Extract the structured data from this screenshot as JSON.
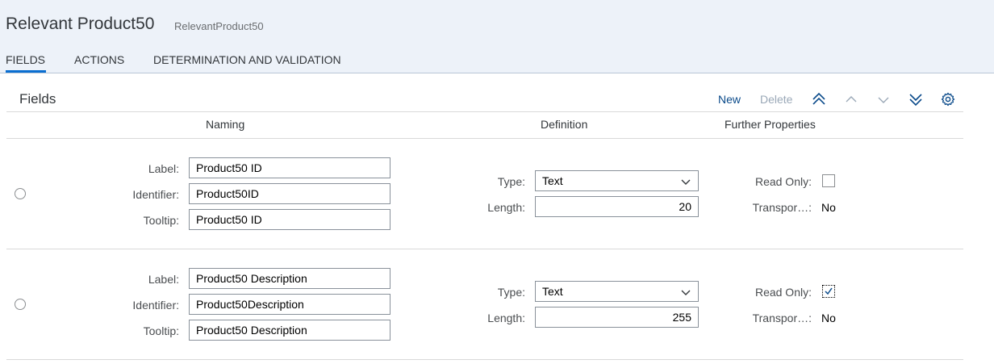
{
  "header": {
    "title": "Relevant Product50",
    "subtitle": "RelevantProduct50",
    "tabs": [
      {
        "label": "FIELDS",
        "active": true
      },
      {
        "label": "ACTIONS",
        "active": false
      },
      {
        "label": "DETERMINATION AND VALIDATION",
        "active": false
      }
    ]
  },
  "section": {
    "title": "Fields",
    "toolbar": {
      "new_label": "New",
      "delete_label": "Delete",
      "icons": [
        "move-to-top-icon",
        "move-up-icon",
        "move-down-icon",
        "move-to-bottom-icon",
        "settings-icon"
      ]
    }
  },
  "columns": [
    "Naming",
    "Definition",
    "Further Properties"
  ],
  "labels": {
    "label": "Label:",
    "identifier": "Identifier:",
    "tooltip": "Tooltip:",
    "type": "Type:",
    "length": "Length:",
    "read_only": "Read Only:",
    "transport": "Transpor…:"
  },
  "rows": [
    {
      "label": "Product50 ID",
      "identifier": "Product50ID",
      "tooltip": "Product50 ID",
      "type": "Text",
      "length": "20",
      "read_only": false,
      "transport": "No"
    },
    {
      "label": "Product50 Description",
      "identifier": "Product50Description",
      "tooltip": "Product50 Description",
      "type": "Text",
      "length": "255",
      "read_only": true,
      "transport": "No"
    }
  ],
  "colors": {
    "accent": "#0a6ed1",
    "header_bg": "#edf2f9",
    "disabled": "#9aa8b7"
  }
}
